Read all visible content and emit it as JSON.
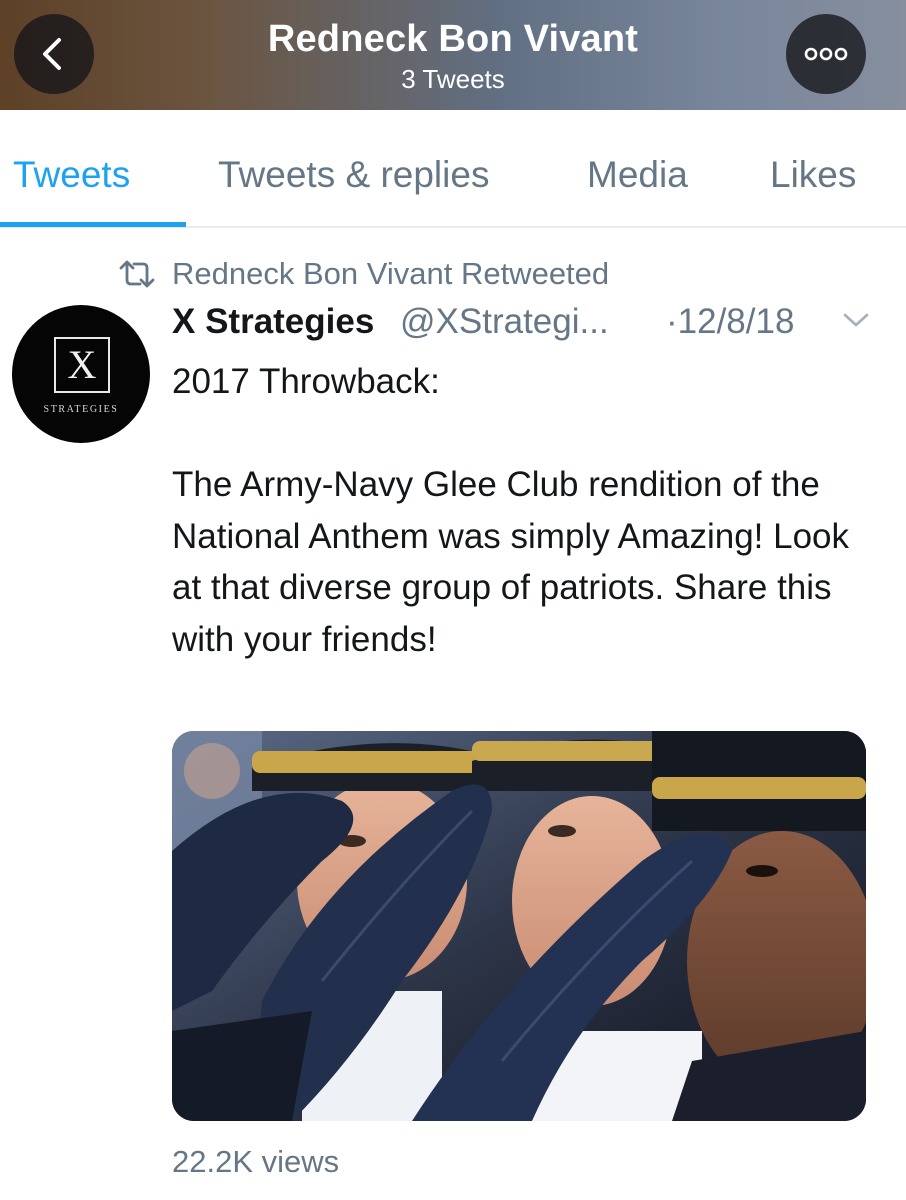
{
  "header": {
    "title": "Redneck Bon Vivant",
    "subtitle": "3 Tweets",
    "back_icon": "chevron-left-icon",
    "more_icon": "more-options-icon"
  },
  "tabs": [
    {
      "label": "Tweets",
      "active": true
    },
    {
      "label": "Tweets & replies",
      "active": false
    },
    {
      "label": "Media",
      "active": false
    },
    {
      "label": "Likes",
      "active": false
    }
  ],
  "tweet": {
    "retweet_note": "Redneck Bon Vivant Retweeted",
    "author_name": "X Strategies",
    "handle": "@XStrategi...",
    "date": "·12/8/18",
    "avatar": {
      "letter": "X",
      "word": "STRATEGIES"
    },
    "text": "2017 Throwback:\n\nThe Army-Navy Glee Club rendition of the National Anthem was simply Amazing! Look at that diverse group of patriots. Share this with your friends!",
    "media_description": "video-thumbnail",
    "views": "22.2K views"
  },
  "colors": {
    "accent": "#1da1f2",
    "secondary_text": "#657786",
    "primary_text": "#14171a"
  }
}
